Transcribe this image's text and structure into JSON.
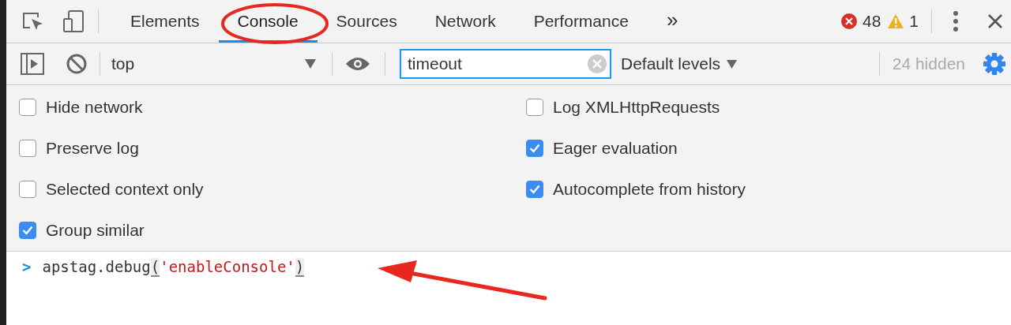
{
  "tabs": [
    {
      "label": "Elements",
      "selected": false
    },
    {
      "label": "Console",
      "selected": true
    },
    {
      "label": "Sources",
      "selected": false
    },
    {
      "label": "Network",
      "selected": false
    },
    {
      "label": "Performance",
      "selected": false
    }
  ],
  "more_tabs": "»",
  "counts": {
    "errors": "48",
    "warnings": "1"
  },
  "toolbar": {
    "context": "top",
    "filter": {
      "value": "timeout"
    },
    "levels": "Default levels",
    "hidden": "24 hidden"
  },
  "settings": [
    {
      "label": "Hide network",
      "checked": false
    },
    {
      "label": "Log XMLHttpRequests",
      "checked": false
    },
    {
      "label": "Preserve log",
      "checked": false
    },
    {
      "label": "Eager evaluation",
      "checked": true
    },
    {
      "label": "Selected context only",
      "checked": false
    },
    {
      "label": "Autocomplete from history",
      "checked": true
    },
    {
      "label": "Group similar",
      "checked": true
    }
  ],
  "console": {
    "prompt": ">",
    "code_parts": [
      {
        "kind": "plain",
        "text": "apstag.debug"
      },
      {
        "kind": "paren",
        "text": "("
      },
      {
        "kind": "string",
        "text": "'enableConsole'"
      },
      {
        "kind": "paren",
        "text": ")"
      }
    ]
  },
  "annotations": [
    {
      "kind": "ellipse"
    },
    {
      "kind": "arrow"
    }
  ]
}
